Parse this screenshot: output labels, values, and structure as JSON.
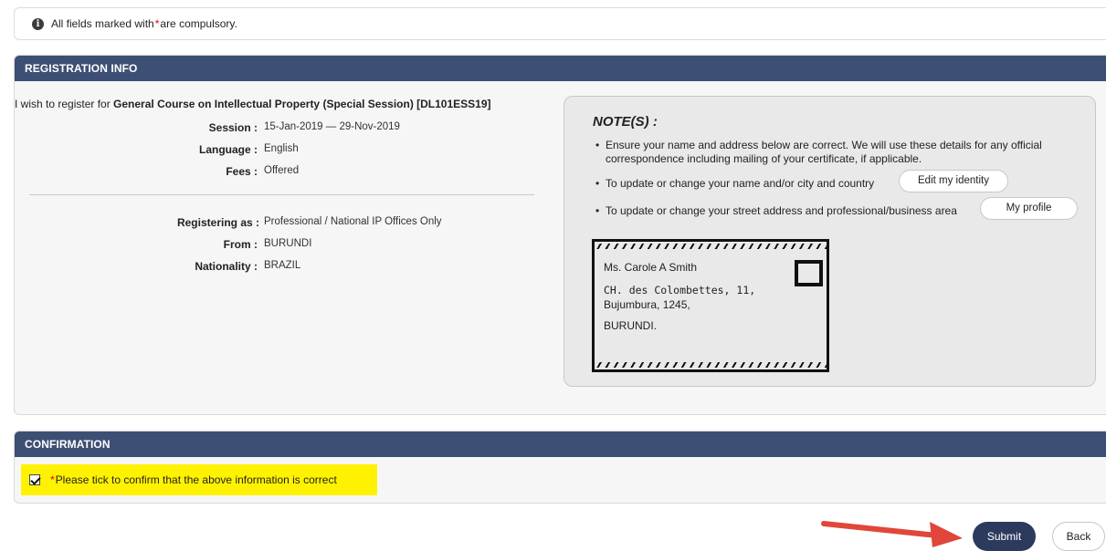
{
  "notice": {
    "prefix": "All fields marked with",
    "star": "*",
    "suffix": "are compulsory."
  },
  "registration": {
    "header": "REGISTRATION INFO",
    "intro": "I wish to register for",
    "course": "General Course on Intellectual Property (Special Session) [DL101ESS19]",
    "session_label": "Session :",
    "session_value": "15-Jan-2019 — 29-Nov-2019",
    "language_label": "Language :",
    "language_value": "English",
    "fees_label": "Fees :",
    "fees_value": "Offered",
    "registering_label": "Registering as :",
    "registering_value": "Professional / National IP Offices Only",
    "from_label": "From :",
    "from_value": "BURUNDI",
    "nationality_label": "Nationality :",
    "nationality_value": "BRAZIL"
  },
  "notes": {
    "title": "NOTE(S) :",
    "items": [
      "Ensure your name and address below are correct. We will use these details for any official correspondence including mailing of your certificate, if applicable.",
      "To update or change your name and/or city and country",
      "To update or change your street address and professional/business area"
    ],
    "edit_identity_label": "Edit my identity",
    "my_profile_label": "My profile"
  },
  "envelope": {
    "name": "Ms. Carole A Smith",
    "street": "CH. des Colombettes, 11,",
    "city": "Bujumbura, 1245,",
    "country": "BURUNDI."
  },
  "confirmation": {
    "header": "CONFIRMATION",
    "star": "*",
    "text": "Please tick to confirm that the above information is correct",
    "checked": true
  },
  "actions": {
    "submit_label": "Submit",
    "back_label": "Back"
  },
  "colors": {
    "header_bg": "#3d4f74",
    "submit_bg": "#2c3b5d",
    "highlight": "#fff200",
    "arrow": "#e0463a",
    "required_star": "#e00000"
  },
  "icons": {
    "notice": "info-icon",
    "annotation": "red-arrow-icon"
  }
}
